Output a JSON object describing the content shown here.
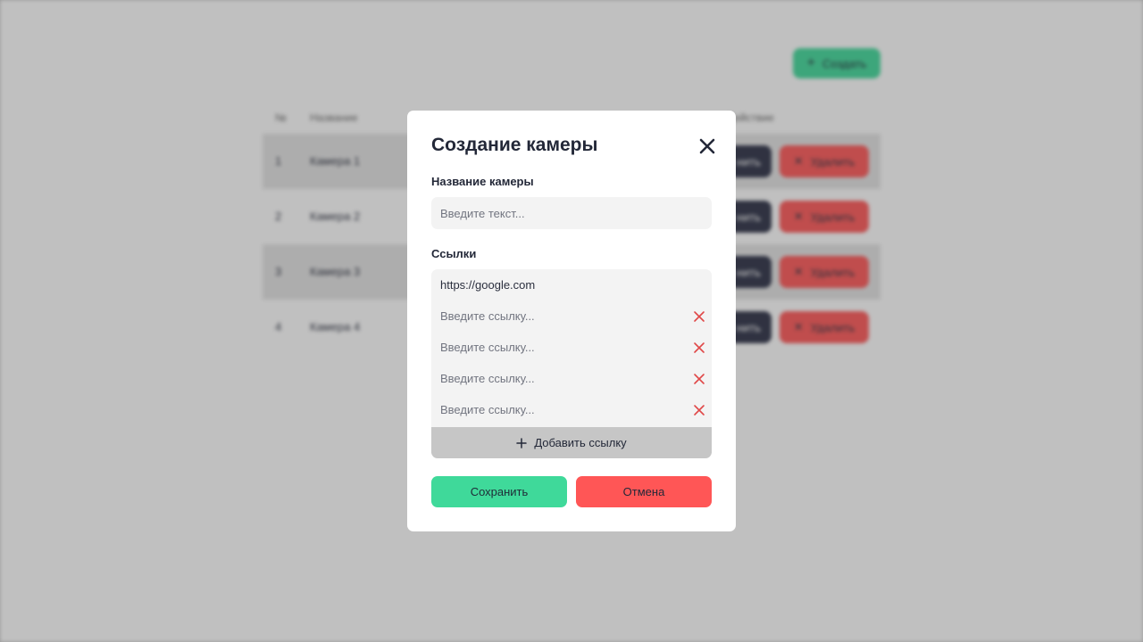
{
  "background": {
    "create_button": {
      "label": "Создать",
      "icon": "plus-icon"
    },
    "table": {
      "headers": [
        "№",
        "Название",
        "Действие"
      ],
      "rows": [
        {
          "num": "1",
          "name": "Камера 1",
          "edit_label": "нить",
          "delete_label": "Удалить"
        },
        {
          "num": "2",
          "name": "Камера 2",
          "edit_label": "нить",
          "delete_label": "Удалить"
        },
        {
          "num": "3",
          "name": "Камера 3",
          "edit_label": "нить",
          "delete_label": "Удалить"
        },
        {
          "num": "4",
          "name": "Камера 4",
          "edit_label": "нить",
          "delete_label": "Удалить"
        }
      ]
    }
  },
  "modal": {
    "title": "Создание камеры",
    "close_icon": "close-icon",
    "name_field": {
      "label": "Название камеры",
      "value": "",
      "placeholder": "Введите текст..."
    },
    "links": {
      "label": "Ссылки",
      "items": [
        {
          "value": "https://google.com",
          "placeholder": "Введите ссылку...",
          "removable": false
        },
        {
          "value": "",
          "placeholder": "Введите ссылку...",
          "removable": true
        },
        {
          "value": "",
          "placeholder": "Введите ссылку...",
          "removable": true
        },
        {
          "value": "",
          "placeholder": "Введите ссылку...",
          "removable": true
        },
        {
          "value": "",
          "placeholder": "Введите ссылку...",
          "removable": true
        }
      ],
      "add_label": "Добавить ссылку"
    },
    "save_label": "Сохранить",
    "cancel_label": "Отмена"
  },
  "colors": {
    "accent_green": "#3fd99a",
    "danger_red": "#ff5656",
    "dark": "#2b2f45",
    "remove_icon": "#e04848"
  }
}
